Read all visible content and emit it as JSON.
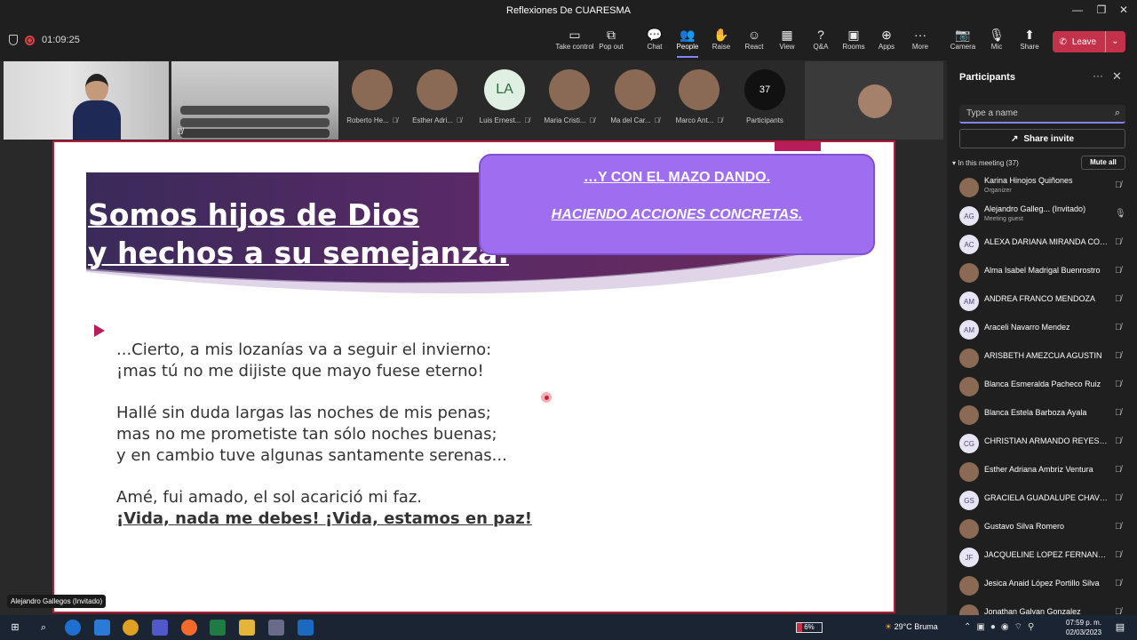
{
  "window": {
    "title": "Reflexiones De CUARESMA"
  },
  "toolbar": {
    "timer": "01:09:25",
    "buttons": [
      {
        "label": "Take control",
        "icon": "take-control-icon"
      },
      {
        "label": "Pop out",
        "icon": "pop-out-icon"
      },
      {
        "label": "Chat",
        "icon": "chat-icon"
      },
      {
        "label": "People",
        "icon": "people-icon",
        "active": true
      },
      {
        "label": "Raise",
        "icon": "raise-hand-icon"
      },
      {
        "label": "React",
        "icon": "react-icon"
      },
      {
        "label": "View",
        "icon": "view-icon"
      },
      {
        "label": "Q&A",
        "icon": "qa-icon"
      },
      {
        "label": "Rooms",
        "icon": "rooms-icon"
      },
      {
        "label": "Apps",
        "icon": "apps-icon"
      },
      {
        "label": "More",
        "icon": "more-icon"
      },
      {
        "label": "Camera",
        "icon": "camera-off-icon"
      },
      {
        "label": "Mic",
        "icon": "mic-off-icon"
      },
      {
        "label": "Share",
        "icon": "share-icon"
      }
    ],
    "leave_label": "Leave"
  },
  "gallery": [
    {
      "name": "Roberto He...",
      "initials": ""
    },
    {
      "name": "Esther Adri...",
      "initials": ""
    },
    {
      "name": "Luis Ernest...",
      "initials": "LA"
    },
    {
      "name": "Maria Cristi...",
      "initials": ""
    },
    {
      "name": "Ma del Car...",
      "initials": ""
    },
    {
      "name": "Marco Ant...",
      "initials": ""
    },
    {
      "name": "Participants",
      "initials": "37"
    }
  ],
  "slide": {
    "title_line1": "Somos hijos de Dios",
    "title_line2": "y hechos a su semejanza.",
    "callout_line1": "…Y CON EL MAZO DANDO.",
    "callout_line2": "HACIENDO ACCIONES CONCRETAS.",
    "poem": [
      [
        "...Cierto, a mis lozanías va a seguir el invierno:",
        "¡mas tú no me dijiste que mayo fuese eterno!"
      ],
      [
        "Hallé sin duda largas las noches de mis penas;",
        "mas no me prometiste tan sólo noches buenas;",
        "y en cambio tuve algunas santamente serenas..."
      ],
      [
        "Amé, fui amado, el sol acarició mi faz."
      ]
    ],
    "closing_line": "¡Vida, nada me debes! ¡Vida, estamos en paz!"
  },
  "speaker_tag": "Alejandro Gallegos (Invitado)",
  "participants_panel": {
    "title": "Participants",
    "search_placeholder": "Type a name",
    "share_invite": "Share invite",
    "in_meeting": "In this meeting (37)",
    "mute_all": "Mute all",
    "people": [
      {
        "name": "Karina Hinojos Quiñones",
        "sub": "Organizer",
        "initials": "",
        "mic": "muted"
      },
      {
        "name": "Alejandro Galleg... (Invitado)",
        "sub": "Meeting guest",
        "initials": "AG",
        "mic": "on"
      },
      {
        "name": "ALEXA DARIANA MIRANDA CON...",
        "sub": "",
        "initials": "AC",
        "mic": "muted"
      },
      {
        "name": "Alma Isabel Madrigal Buenrostro",
        "sub": "",
        "initials": "",
        "mic": "muted"
      },
      {
        "name": "ANDREA FRANCO MENDOZA",
        "sub": "",
        "initials": "AM",
        "mic": "muted"
      },
      {
        "name": "Araceli Navarro Mendez",
        "sub": "",
        "initials": "AM",
        "mic": "muted"
      },
      {
        "name": "ARISBETH AMEZCUA AGUSTIN",
        "sub": "",
        "initials": "",
        "mic": "muted"
      },
      {
        "name": "Blanca Esmeralda Pacheco Ruiz",
        "sub": "",
        "initials": "",
        "mic": "muted"
      },
      {
        "name": "Blanca Estela Barboza Ayala",
        "sub": "",
        "initials": "",
        "mic": "muted"
      },
      {
        "name": "CHRISTIAN ARMANDO REYES G...",
        "sub": "",
        "initials": "CG",
        "mic": "muted"
      },
      {
        "name": "Esther Adriana Ambriz Ventura",
        "sub": "",
        "initials": "",
        "mic": "muted"
      },
      {
        "name": "GRACIELA GUADALUPE CHAVEZ ...",
        "sub": "",
        "initials": "GS",
        "mic": "muted"
      },
      {
        "name": "Gustavo Silva Romero",
        "sub": "",
        "initials": "",
        "mic": "muted"
      },
      {
        "name": "JACQUELINE LOPEZ FERNANDEZ",
        "sub": "",
        "initials": "JF",
        "mic": "muted"
      },
      {
        "name": "Jesica Anaid López Portillo Silva",
        "sub": "",
        "initials": "",
        "mic": "muted"
      },
      {
        "name": "Jonathan Galvan Gonzalez",
        "sub": "",
        "initials": "",
        "mic": "muted"
      }
    ]
  },
  "taskbar": {
    "battery": "6%",
    "weather": "29°C  Bruma",
    "time": "07:59 p. m.",
    "date": "02/03/2023"
  },
  "colors": {
    "accent": "#7f85f5",
    "leave": "#c4314b",
    "slide_border": "#b81c3b",
    "callout": "#9f6ef0"
  }
}
